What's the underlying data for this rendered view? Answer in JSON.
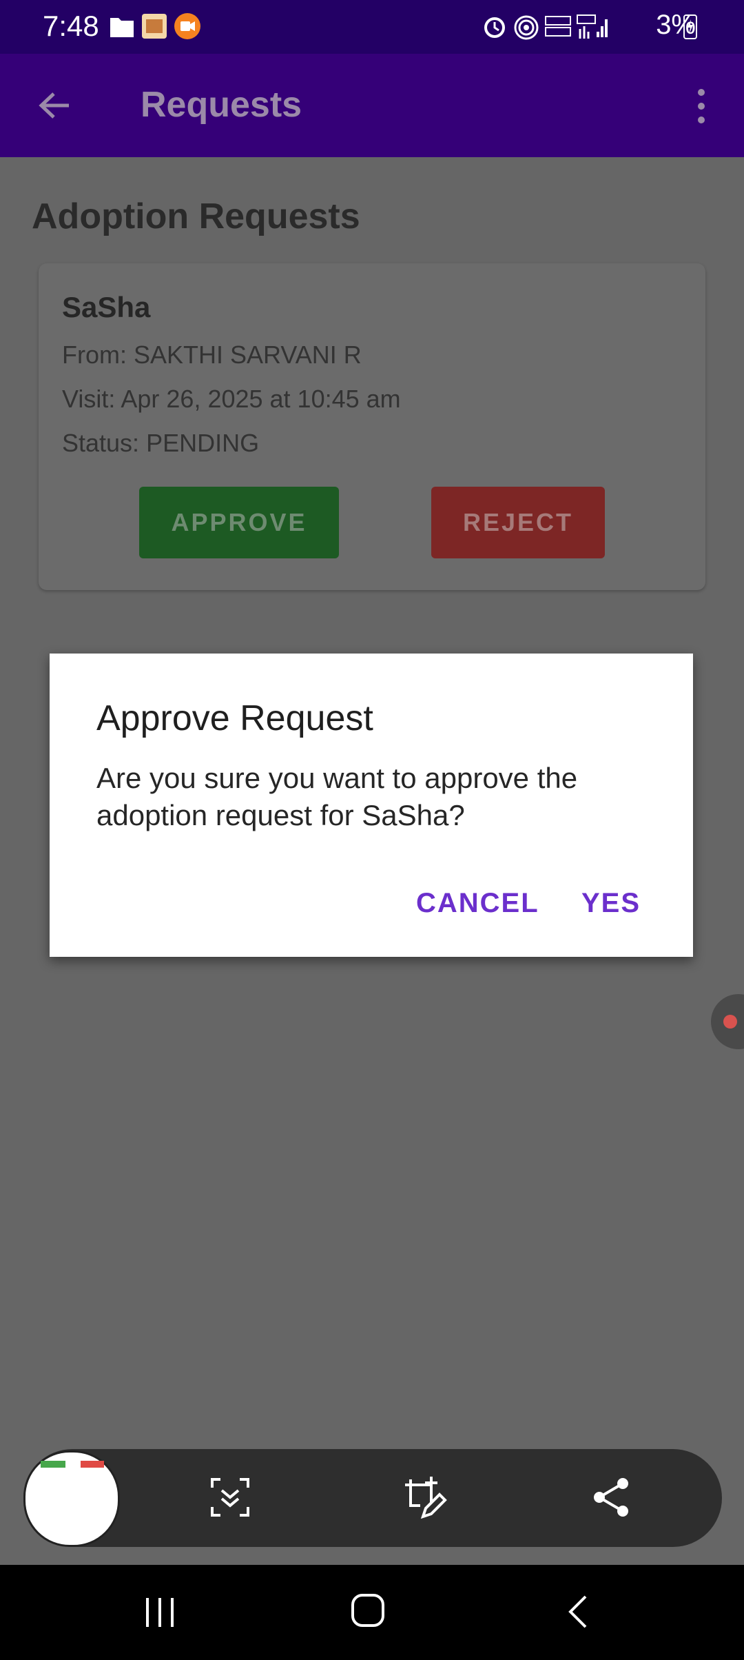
{
  "status_bar": {
    "time": "7:48",
    "battery": "3%"
  },
  "app_bar": {
    "title": "Requests"
  },
  "page": {
    "heading": "Adoption Requests"
  },
  "request_card": {
    "pet_name": "SaSha",
    "from": "From: SAKTHI SARVANI R",
    "visit": "Visit: Apr 26, 2025 at 10:45 am",
    "status": "Status: PENDING",
    "approve_label": "APPROVE",
    "reject_label": "REJECT"
  },
  "dialog": {
    "title": "Approve Request",
    "message": "Are you sure you want to approve the adoption request for SaSha?",
    "cancel_label": "CANCEL",
    "confirm_label": "YES"
  },
  "colors": {
    "status_bar": "#230065",
    "app_bar": "#350078",
    "scrim": "#666666",
    "approve": "#2e7d32",
    "reject": "#c62828",
    "dialog_action": "#6b2fcc"
  }
}
